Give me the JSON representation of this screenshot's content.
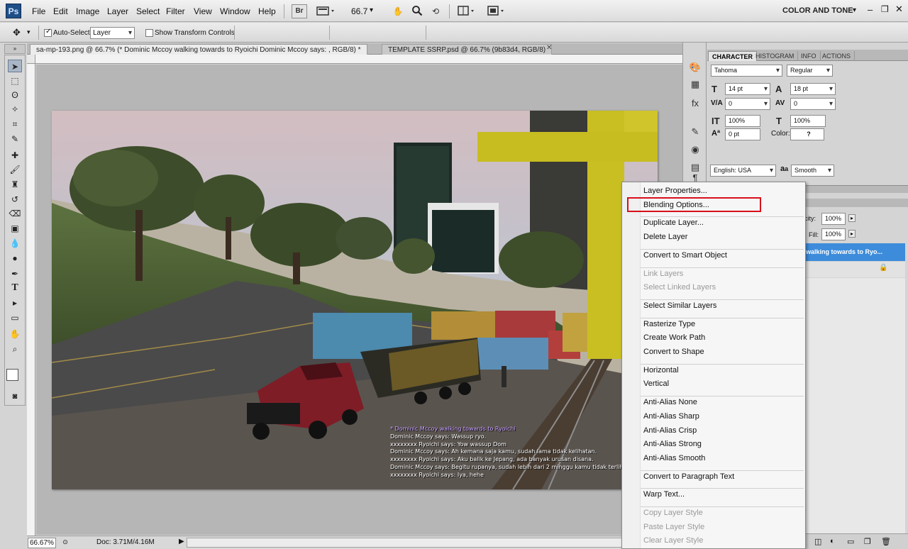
{
  "app": {
    "logo": "Ps",
    "workspace": "COLOR AND TONE"
  },
  "menu": [
    "File",
    "Edit",
    "Image",
    "Layer",
    "Select",
    "Filter",
    "View",
    "Window",
    "Help"
  ],
  "toolbar": {
    "bridge_label": "Br",
    "zoom": "66.7"
  },
  "options": {
    "auto_select_label": "Auto-Select:",
    "auto_select_value": "Layer",
    "show_transform_label": "Show Transform Controls"
  },
  "tabs": [
    {
      "label": "sa-mp-193.png @ 66.7% (* Dominic Mccoy walking towards to Ryoichi Dominic Mccoy says: , RGB/8) *",
      "active": true
    },
    {
      "label": "TEMPLATE SSRP.psd @ 66.7% (9b83d4, RGB/8)",
      "active": false
    }
  ],
  "status": {
    "zoom": "66.67%",
    "doc": "Doc: 3.71M/4.16M"
  },
  "chat": [
    {
      "text": "* Dominic Mccoy walking towards to Ryoichi",
      "color": "#c7a0ff"
    },
    {
      "text": "Dominic Mccoy says: Wassup ryo.",
      "color": "#ffffff"
    },
    {
      "text": "xxxxxxxx Ryoichi says: Yow wassup Dom",
      "color": "#ffffff"
    },
    {
      "text": "Dominic Mccoy says: Ah kemana saja kamu, sudah lama tidak kelihatan.",
      "color": "#ffffff"
    },
    {
      "text": "xxxxxxxx Ryoichi says: Aku balik ke Jepang, ada banyak urusan disana.",
      "color": "#ffffff"
    },
    {
      "text": "Dominic Mccoy says: Begitu rupanya, sudah lebih dari 2 minggu kamu tidak terlihat",
      "color": "#ffffff"
    },
    {
      "text": "xxxxxxxx Ryoichi says: Iya, hehe",
      "color": "#ffffff"
    }
  ],
  "panel_tabs": [
    "CHARACTER",
    "HISTOGRAM",
    "INFO",
    "ACTIONS"
  ],
  "character": {
    "font": "Tahoma",
    "style": "Regular",
    "size": "14 pt",
    "leading": "18 pt",
    "kerning": "0",
    "tracking": "0",
    "vscale": "100%",
    "hscale": "100%",
    "baseline": "0 pt",
    "color_label": "Color:",
    "color_value": "?",
    "language": "English: USA",
    "antialias": "Smooth",
    "aa_label": "a",
    "style_buttons": [
      "T",
      "T",
      "TT",
      "Tr",
      "T¹",
      "T₁",
      "T",
      "Ŧ"
    ]
  },
  "layers": {
    "opacity_label": "city:",
    "opacity": "100%",
    "fill_label": "Fill:",
    "fill": "100%",
    "layer_name": "walking towards to Ryo..."
  },
  "context_menu": [
    {
      "label": "Layer Properties...",
      "enabled": true
    },
    {
      "label": "Blending Options...",
      "enabled": true
    },
    {
      "sep": true
    },
    {
      "label": "Duplicate Layer...",
      "enabled": true
    },
    {
      "label": "Delete Layer",
      "enabled": true
    },
    {
      "sep": true
    },
    {
      "label": "Convert to Smart Object",
      "enabled": true
    },
    {
      "sep": true
    },
    {
      "label": "Link Layers",
      "enabled": false
    },
    {
      "label": "Select Linked Layers",
      "enabled": false
    },
    {
      "sep": true
    },
    {
      "label": "Select Similar Layers",
      "enabled": true
    },
    {
      "sep": true
    },
    {
      "label": "Rasterize Type",
      "enabled": true
    },
    {
      "label": "Create Work Path",
      "enabled": true
    },
    {
      "label": "Convert to Shape",
      "enabled": true
    },
    {
      "sep": true
    },
    {
      "label": "Horizontal",
      "enabled": true
    },
    {
      "label": "Vertical",
      "enabled": true
    },
    {
      "sep": true
    },
    {
      "label": "Anti-Alias None",
      "enabled": true
    },
    {
      "label": "Anti-Alias Sharp",
      "enabled": true
    },
    {
      "label": "Anti-Alias Crisp",
      "enabled": true
    },
    {
      "label": "Anti-Alias Strong",
      "enabled": true
    },
    {
      "label": "Anti-Alias Smooth",
      "enabled": true
    },
    {
      "sep": true
    },
    {
      "label": "Convert to Paragraph Text",
      "enabled": true
    },
    {
      "sep": true
    },
    {
      "label": "Warp Text...",
      "enabled": true
    },
    {
      "sep": true
    },
    {
      "label": "Copy Layer Style",
      "enabled": false
    },
    {
      "label": "Paste Layer Style",
      "enabled": false
    },
    {
      "label": "Clear Layer Style",
      "enabled": false
    }
  ]
}
